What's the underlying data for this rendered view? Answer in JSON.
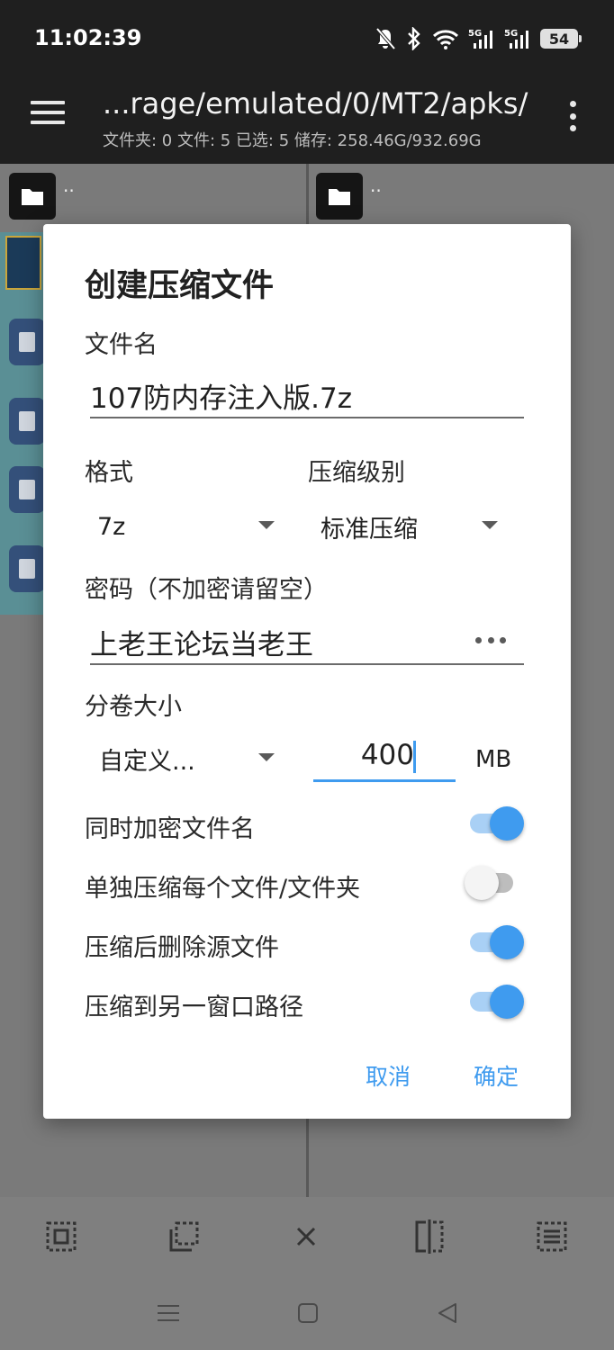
{
  "status": {
    "time": "11:02:39",
    "battery": "54",
    "net1": "5G",
    "net2": "5G"
  },
  "appbar": {
    "path": "...rage/emulated/0/MT2/apks/",
    "summary": "文件夹: 0  文件: 5  已选: 5  储存: 258.46G/932.69G"
  },
  "panels": {
    "left_parent": "··",
    "right_parent": "··"
  },
  "dialog": {
    "title": "创建压缩文件",
    "filename_label": "文件名",
    "filename_value": "107防内存注入版.7z",
    "format_label": "格式",
    "format_value": "7z",
    "level_label": "压缩级别",
    "level_value": "标准压缩",
    "password_label": "密码（不加密请留空）",
    "password_value": "上老王论坛当老王",
    "volume_label": "分卷大小",
    "volume_mode": "自定义...",
    "volume_size": "400",
    "volume_unit": "MB",
    "options": [
      {
        "label": "同时加密文件名",
        "on": true
      },
      {
        "label": "单独压缩每个文件/文件夹",
        "on": false
      },
      {
        "label": "压缩后删除源文件",
        "on": true
      },
      {
        "label": "压缩到另一窗口路径",
        "on": true
      }
    ],
    "cancel_label": "取消",
    "ok_label": "确定"
  },
  "colors": {
    "accent": "#3f9bef",
    "appbar": "#1f1f1f"
  }
}
